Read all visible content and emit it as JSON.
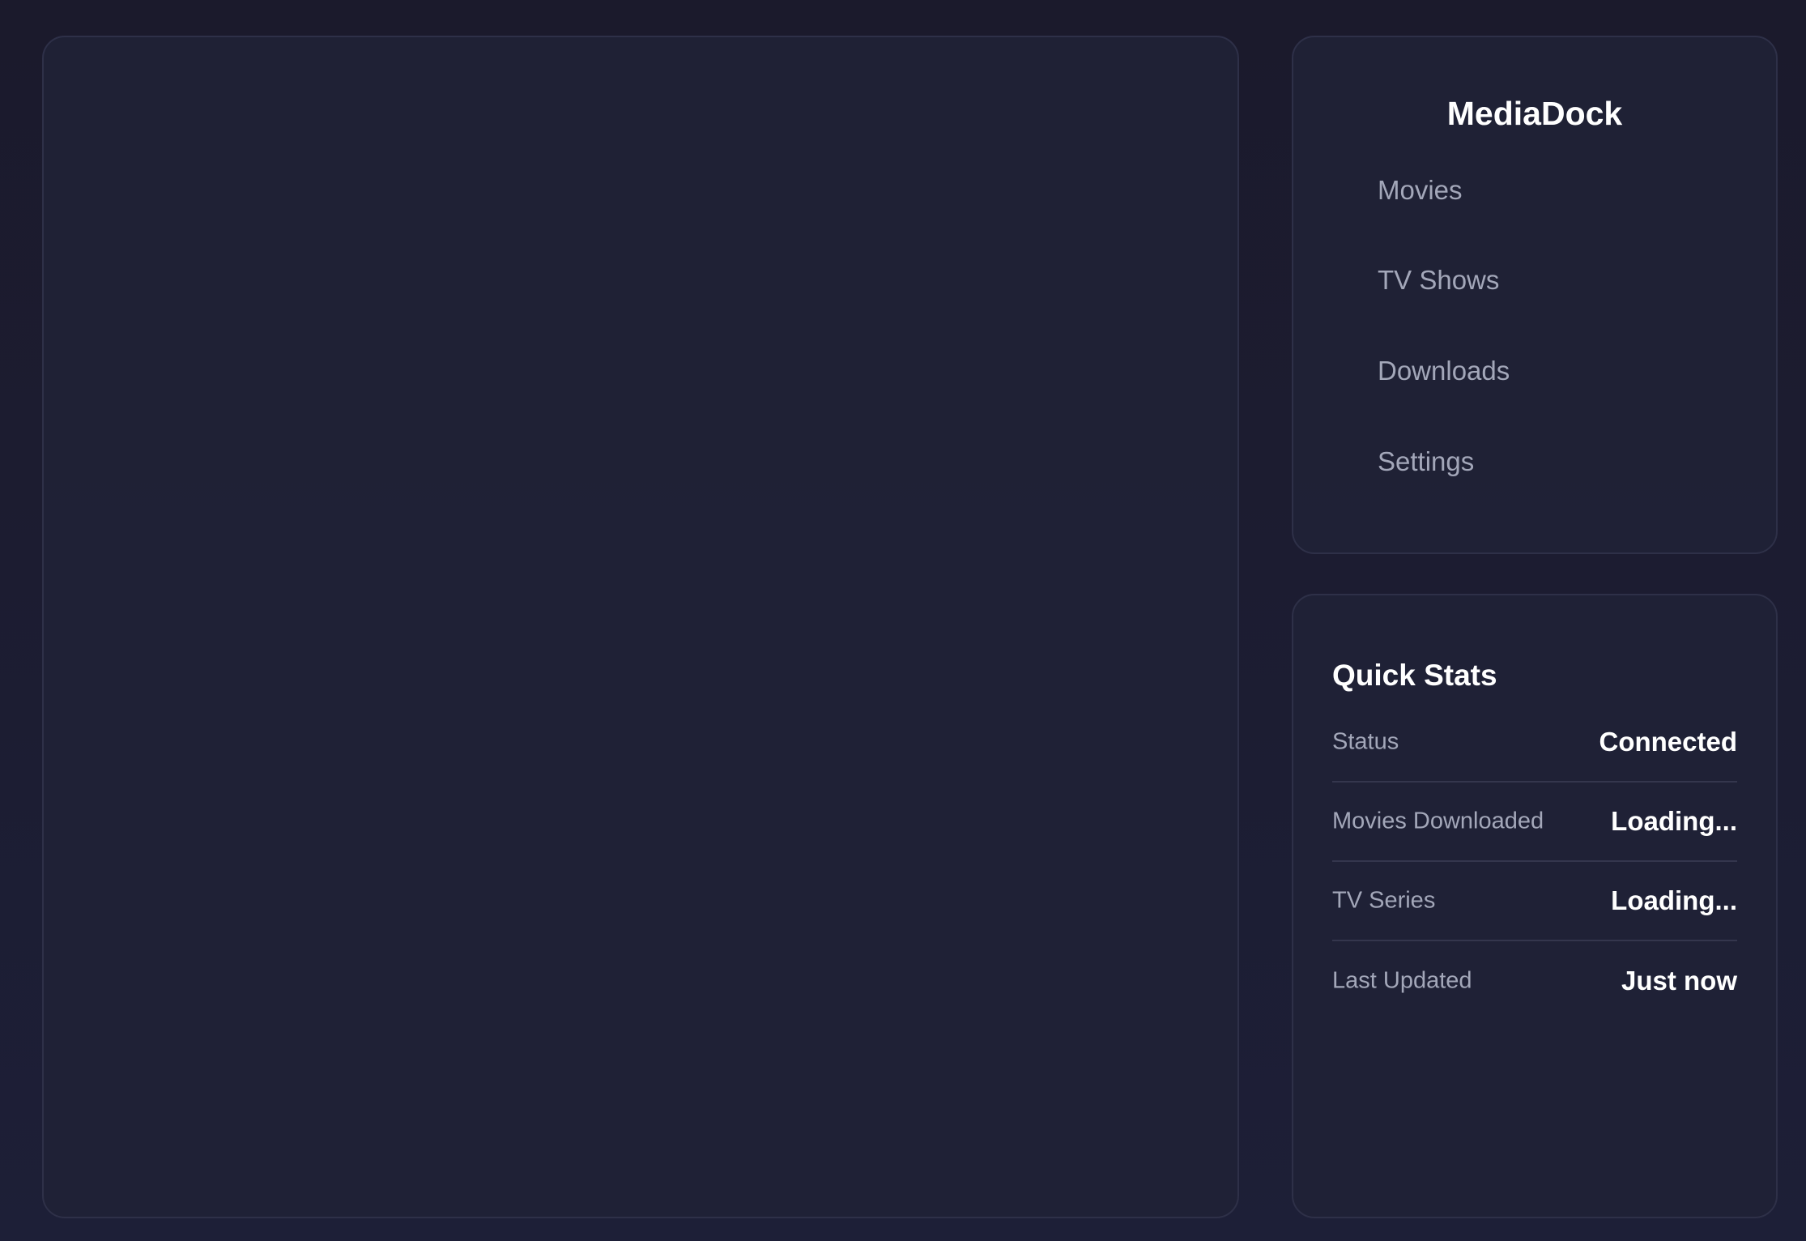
{
  "app": {
    "title": "MediaDock"
  },
  "nav": {
    "items": [
      {
        "label": "Movies",
        "icon": ""
      },
      {
        "label": "TV Shows",
        "icon": ""
      },
      {
        "label": "Downloads",
        "icon": ""
      },
      {
        "label": "Settings",
        "icon": ""
      }
    ]
  },
  "stats": {
    "title": "Quick Stats",
    "rows": [
      {
        "label": "Status",
        "value": "Connected"
      },
      {
        "label": "Movies Downloaded",
        "value": "Loading..."
      },
      {
        "label": "TV Series",
        "value": "Loading..."
      },
      {
        "label": "Last Updated",
        "value": "Just now"
      }
    ]
  },
  "colors": {
    "background_top": "#1b1a2c",
    "background_bottom": "#1d1f37",
    "panel": "#202236",
    "panel_border": "#2e3048",
    "text_primary": "#ffffff",
    "text_secondary": "#a3a7b9"
  }
}
